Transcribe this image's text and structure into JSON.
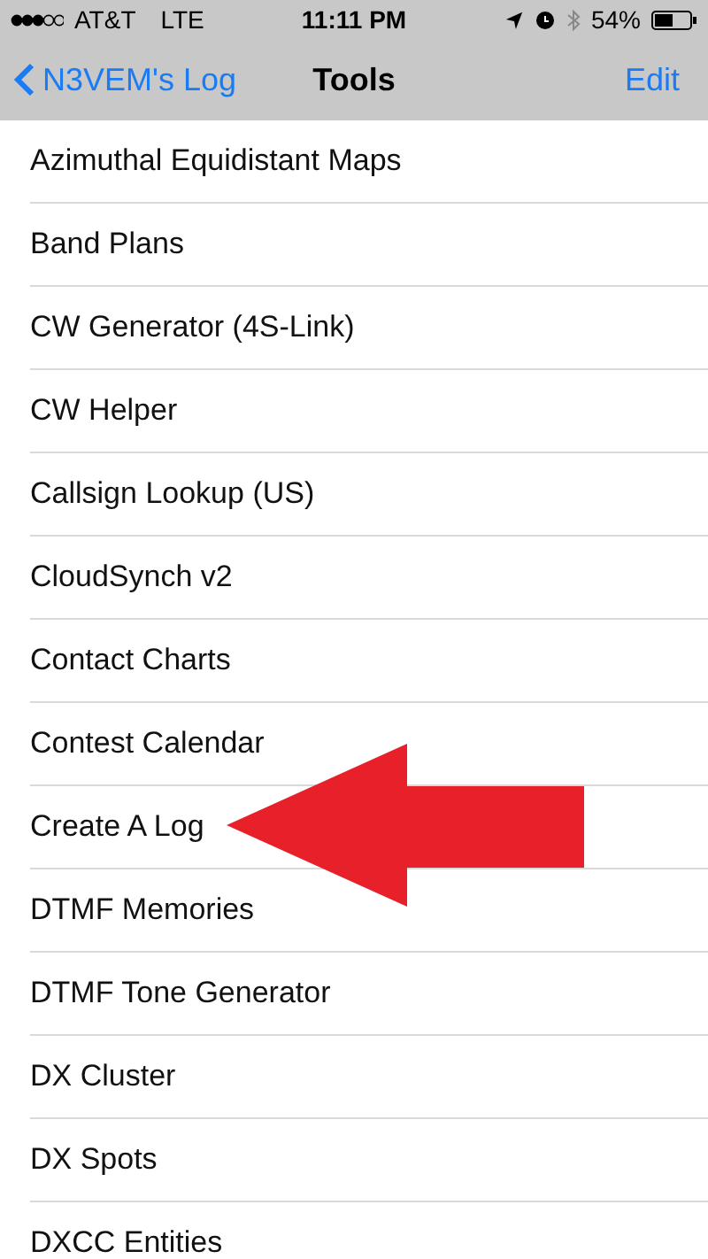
{
  "status_bar": {
    "carrier": "AT&T",
    "network": "LTE",
    "time": "11:11 PM",
    "battery": "54%"
  },
  "nav": {
    "back": "N3VEM's Log",
    "title": "Tools",
    "action": "Edit"
  },
  "items": [
    "Azimuthal Equidistant Maps",
    "Band Plans",
    "CW Generator (4S-Link)",
    "CW Helper",
    "Callsign Lookup (US)",
    "CloudSynch v2",
    "Contact Charts",
    "Contest Calendar",
    "Create A Log",
    "DTMF Memories",
    "DTMF Tone Generator",
    "DX Cluster",
    "DX Spots",
    "DXCC Entities"
  ]
}
